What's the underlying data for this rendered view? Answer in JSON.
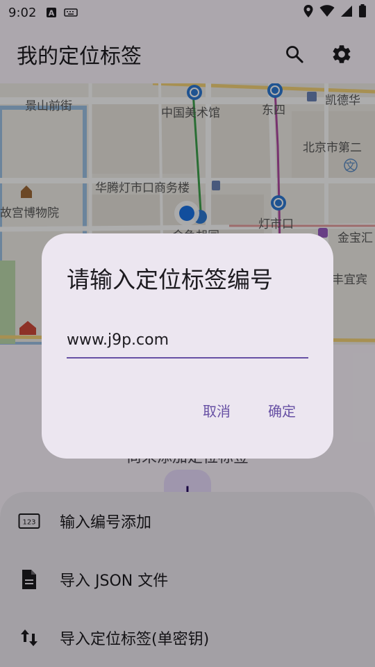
{
  "status_bar": {
    "time": "9:02"
  },
  "app_bar": {
    "title": "我的定位标签"
  },
  "map": {
    "labels": [
      "景山前街",
      "中国美术馆",
      "东四",
      "凯德华",
      "北京市第二",
      "华腾灯市口商务楼",
      "故宫博物院",
      "灯市口",
      "金宝汇",
      "金鱼胡同",
      "丰宜宾",
      "文"
    ]
  },
  "page": {
    "empty_text": "尚未添加定位标签",
    "fab_label": "+"
  },
  "dialog": {
    "title": "请输入定位标签编号",
    "input_value": "www.j9p.com",
    "cancel_label": "取消",
    "confirm_label": "确定"
  },
  "sheet": {
    "items": [
      {
        "label": "输入编号添加",
        "icon": "numbers-icon"
      },
      {
        "label": "导入 JSON 文件",
        "icon": "file-icon"
      },
      {
        "label": "导入定位标签(单密钥)",
        "icon": "swap-vert-icon"
      }
    ]
  },
  "colors": {
    "primary": "#6750a4",
    "surface": "#fef7ff",
    "dialog_bg": "#ece6f0"
  }
}
